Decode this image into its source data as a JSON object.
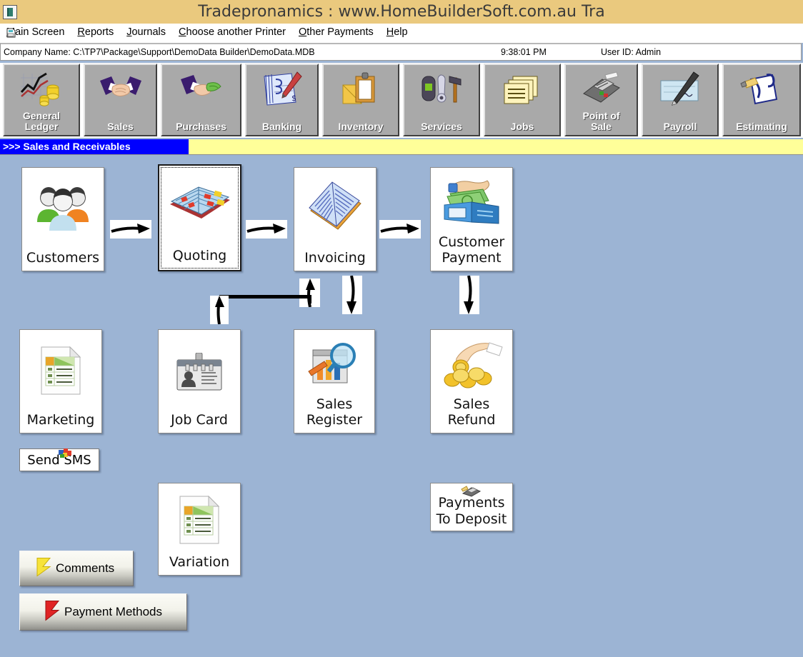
{
  "window": {
    "title": "Tradepronamics :   www.HomeBuilderSoft.com.au    Tra",
    "icon": "app-window-icon"
  },
  "menubar": {
    "icon": "document-icon",
    "items": [
      {
        "accel": "M",
        "rest": "ain Screen"
      },
      {
        "accel": "R",
        "rest": "eports"
      },
      {
        "accel": "J",
        "rest": "ournals"
      },
      {
        "accel": "C",
        "rest": "hoose another Printer"
      },
      {
        "accel": "O",
        "rest": "ther Payments"
      },
      {
        "accel": "H",
        "rest": "elp"
      }
    ]
  },
  "statusbar": {
    "company": "Company Name: C:\\TP7\\Package\\Support\\DemoData Builder\\DemoData.MDB",
    "time": "9:38:01 PM",
    "user": "User ID: Admin"
  },
  "toolbar": {
    "buttons": [
      {
        "label": "General\nLedger",
        "icon": "line-chart-coins-icon"
      },
      {
        "label": "Sales",
        "icon": "handshake-icon"
      },
      {
        "label": "Purchases",
        "icon": "hand-money-icon"
      },
      {
        "label": "Banking",
        "icon": "cheque-pen-icon"
      },
      {
        "label": "Inventory",
        "icon": "clipboard-box-icon"
      },
      {
        "label": "Services",
        "icon": "tools-icon"
      },
      {
        "label": "Jobs",
        "icon": "stacked-pages-icon"
      },
      {
        "label": "Point of\nSale",
        "icon": "card-terminal-icon"
      },
      {
        "label": "Payroll",
        "icon": "cheque-signature-icon"
      },
      {
        "label": "Estimating",
        "icon": "clipboard-pencil-icon"
      }
    ]
  },
  "banner": {
    "label": ">>>  Sales and Receivables",
    "bar_color": "#ffff99",
    "label_color": "#0000ff"
  },
  "workflow": {
    "row1": [
      {
        "label": "Customers",
        "icon": "people-group-icon",
        "focused": false
      },
      {
        "label": "Quoting",
        "icon": "open-book-colored-icon",
        "focused": true
      },
      {
        "label": "Invoicing",
        "icon": "blue-open-book-icon",
        "focused": false
      },
      {
        "label": "Customer\nPayment",
        "icon": "hand-cash-wallet-icon",
        "focused": false
      }
    ],
    "row2": [
      {
        "label": "Marketing",
        "icon": "spreadsheet-page-icon",
        "focused": false
      },
      {
        "label": "Job Card",
        "icon": "id-badge-icon",
        "focused": false
      },
      {
        "label": "Sales\nRegister",
        "icon": "chart-magnifier-icon",
        "focused": false
      },
      {
        "label": "Sales\nRefund",
        "icon": "hand-coins-icon",
        "focused": false
      }
    ],
    "row3": [
      {
        "label": "Variation",
        "icon": "spreadsheet-page-icon",
        "focused": false
      },
      {
        "label": "Payments\nTo Deposit",
        "icon": "cash-register-small-icon",
        "focused": false
      }
    ],
    "arrows": [
      {
        "name": "arrow-customers-to-quoting",
        "dir": "right"
      },
      {
        "name": "arrow-quoting-to-invoicing",
        "dir": "right"
      },
      {
        "name": "arrow-invoicing-to-customer-payment",
        "dir": "right"
      },
      {
        "name": "arrow-up-to-invoicing",
        "dir": "up"
      },
      {
        "name": "arrow-up-from-job-card",
        "dir": "up"
      },
      {
        "name": "arrow-down-to-sales-register",
        "dir": "down"
      },
      {
        "name": "arrow-down-to-sales-refund",
        "dir": "down"
      }
    ]
  },
  "buttons": {
    "send_sms": {
      "label": "Send SMS",
      "icon": "sms-colored-icon"
    },
    "comments": {
      "label": "Comments",
      "icon": "yellow-flag-icon"
    },
    "payment_methods": {
      "label": "Payment Methods",
      "icon": "red-flag-icon"
    }
  },
  "colors": {
    "titlebar": "#eac97e",
    "canvas": "#9cb4d4",
    "toolbar_button": "#a9a9a9",
    "banner_yellow": "#ffff99",
    "banner_blue": "#0000ff"
  }
}
